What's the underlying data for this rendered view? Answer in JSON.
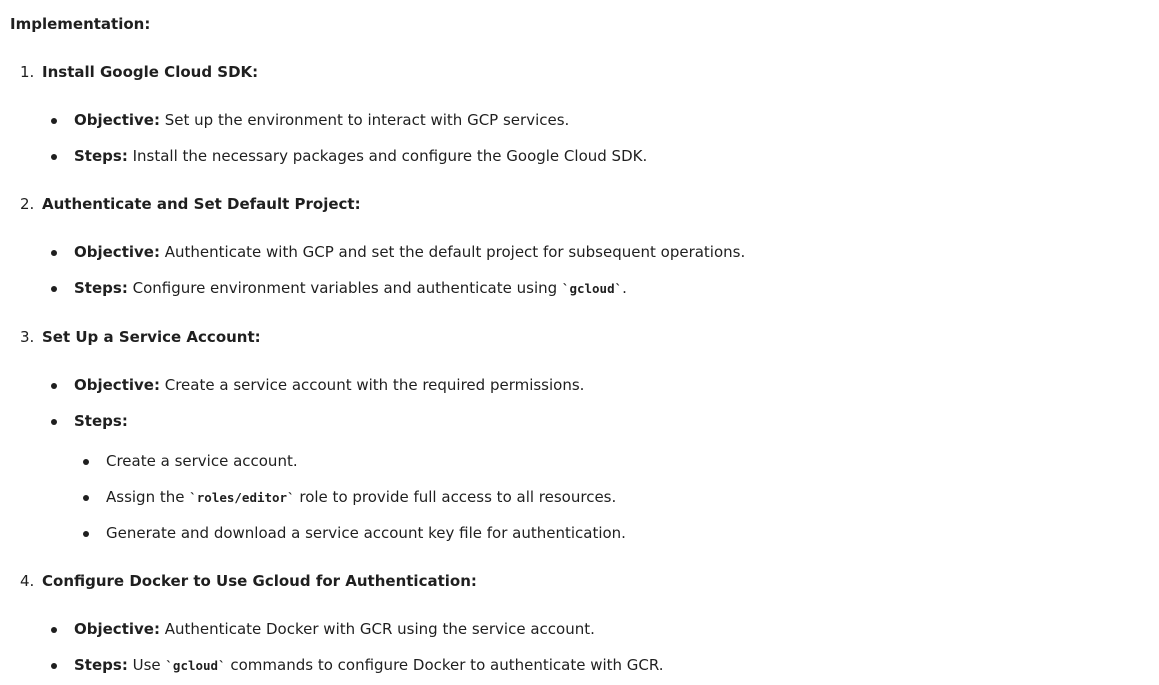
{
  "heading": "Implementation:",
  "steps": [
    {
      "number": "1.",
      "title": "Install Google Cloud SDK:",
      "objective_label": "Objective:",
      "objective_text": "Set up the environment to interact with GCP services.",
      "steps_label": "Steps:",
      "steps_text": "Install the necessary packages and configure the Google Cloud SDK."
    },
    {
      "number": "2.",
      "title": "Authenticate and Set Default Project:",
      "objective_label": "Objective:",
      "objective_text": "Authenticate with GCP and set the default project for subsequent operations.",
      "steps_label": "Steps:",
      "steps_text_before": "Configure environment variables and authenticate using ",
      "steps_code": "`gcloud`",
      "steps_text_after": "."
    },
    {
      "number": "3.",
      "title": "Set Up a Service Account:",
      "objective_label": "Objective:",
      "objective_text": "Create a service account with the required permissions.",
      "steps_label": "Steps:",
      "sub_items": [
        {
          "text": "Create a service account."
        },
        {
          "text_before": "Assign the ",
          "code": "`roles/editor`",
          "text_after": " role to provide full access to all resources."
        },
        {
          "text": "Generate and download a service account key file for authentication."
        }
      ]
    },
    {
      "number": "4.",
      "title": "Configure Docker to Use Gcloud for Authentication:",
      "objective_label": "Objective:",
      "objective_text": "Authenticate Docker with GCR using the service account.",
      "steps_label": "Steps:",
      "steps_text_before": "Use ",
      "steps_code": "`gcloud`",
      "steps_text_after": " commands to configure Docker to authenticate with GCR."
    }
  ]
}
